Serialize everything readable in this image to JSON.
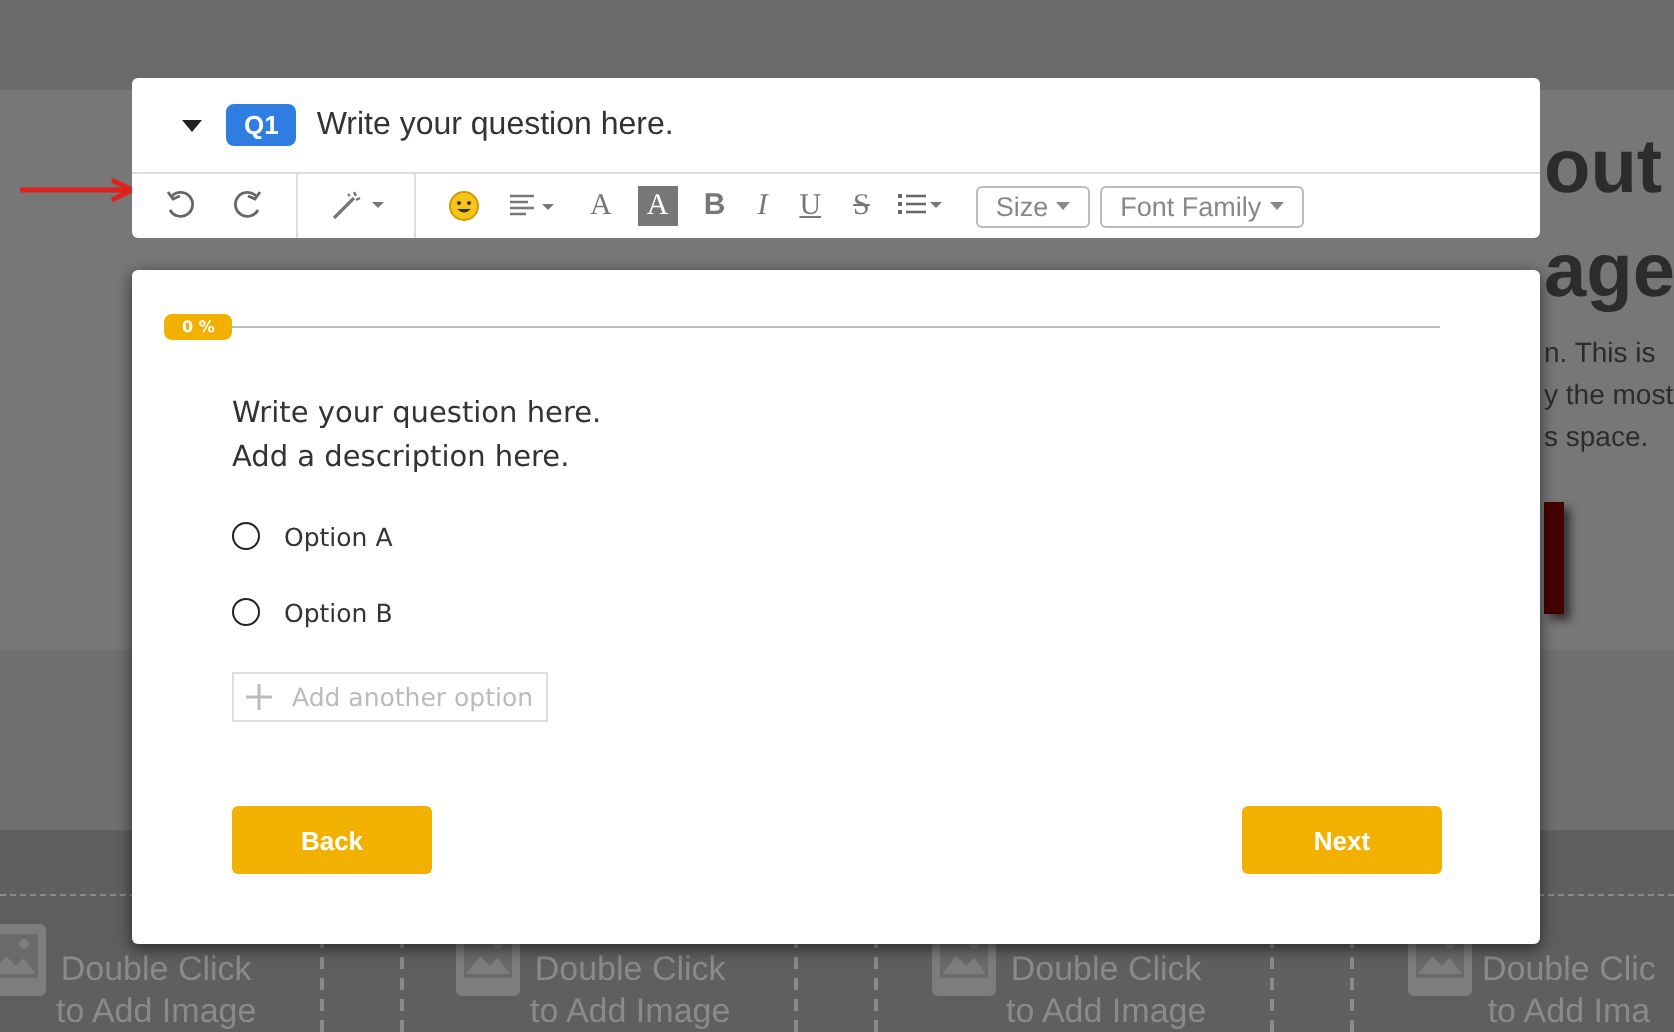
{
  "background_page": {
    "headline_fragments": [
      "out",
      "age"
    ],
    "paragraph_fragments": [
      "n. This is",
      "y the most",
      "s space."
    ],
    "image_slots": [
      {
        "line_1": "Double Click",
        "line_2": "to Add Image"
      },
      {
        "line_1": "Double Click",
        "line_2": "to Add Image"
      },
      {
        "line_1": "Double Click",
        "line_2": "to Add Image"
      },
      {
        "line_1": "Double Clic",
        "line_2": "to Add Ima"
      }
    ]
  },
  "editor_toolbar": {
    "expanded": true,
    "question_badge": "Q1",
    "question_title": "Write your question here.",
    "format_buttons": [
      {
        "label": "A",
        "kind": "color"
      },
      {
        "label": "A",
        "kind": "highlight"
      },
      {
        "label": "B",
        "kind": "bold"
      },
      {
        "label": "I",
        "kind": "italic"
      },
      {
        "label": "U",
        "kind": "underline"
      },
      {
        "label": "S",
        "kind": "strike"
      }
    ],
    "size_select": "Size",
    "font_select": "Font Family"
  },
  "form": {
    "progress_label": "0 %",
    "question": "Write your question here.",
    "description": "Add a description here.",
    "options": [
      {
        "label": "Option A",
        "selected": false
      },
      {
        "label": "Option B",
        "selected": false
      }
    ],
    "add_option_placeholder": "Add another option",
    "buttons": [
      "Back",
      "Next"
    ]
  }
}
